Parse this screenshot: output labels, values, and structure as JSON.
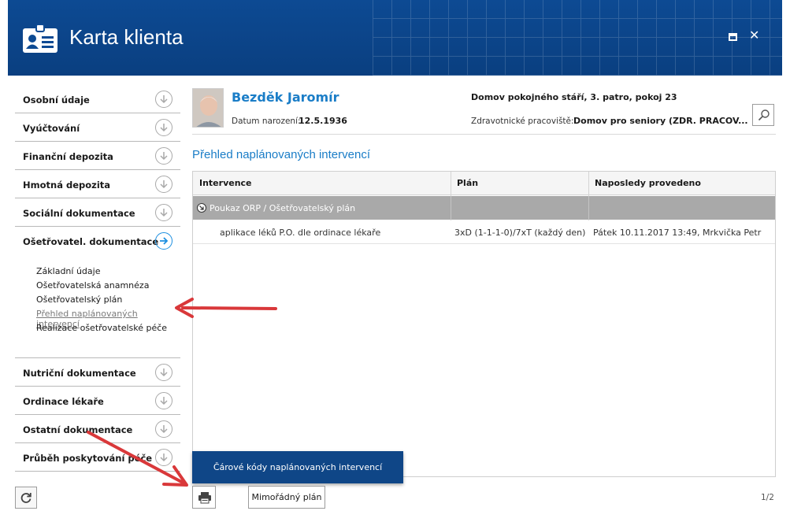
{
  "window": {
    "title": "Karta klienta",
    "maximize_icon": "maximize-icon",
    "close_icon": "close-icon"
  },
  "sidebar": {
    "sections_top": [
      {
        "label": "Osobní údaje",
        "icon": "chevron-down-circle-icon"
      },
      {
        "label": "Vyúčtování",
        "icon": "chevron-down-circle-icon"
      },
      {
        "label": "Finanční depozita",
        "icon": "chevron-down-circle-icon"
      },
      {
        "label": "Hmotná depozita",
        "icon": "chevron-down-circle-icon"
      },
      {
        "label": "Sociální dokumentace",
        "icon": "chevron-down-circle-icon"
      }
    ],
    "active_section": {
      "label": "Ošetřovatel. dokumentace",
      "icon": "arrow-right-circle-icon"
    },
    "subitems": [
      {
        "label": "Základní údaje"
      },
      {
        "label": "Ošetřovatelská anamnéza"
      },
      {
        "label": "Ošetřovatelský plán"
      },
      {
        "label": "Přehled naplánovaných intervencí",
        "current": true
      },
      {
        "label": "Realizace ošetřovatelské péče"
      }
    ],
    "sections_bottom": [
      {
        "label": "Nutriční dokumentace",
        "icon": "chevron-down-circle-icon"
      },
      {
        "label": "Ordinace lékaře",
        "icon": "chevron-down-circle-icon"
      },
      {
        "label": "Ostatní dokumentace",
        "icon": "chevron-down-circle-icon"
      },
      {
        "label": "Průběh poskytování péče",
        "icon": "chevron-down-circle-icon"
      }
    ],
    "refresh_icon": "refresh-icon"
  },
  "client": {
    "name": "Bezděk Jaromír",
    "dob_label": "Datum narození:",
    "dob_value": "12.5.1936",
    "location": "Domov pokojného stáří, 3. patro, pokoj 23",
    "workplace_label": "Zdravotnické pracoviště:",
    "workplace_value": "Domov pro seniory (ZDR. PRACOV..."
  },
  "main": {
    "section_title": "Přehled naplánovaných intervencí",
    "table": {
      "columns": [
        "Intervence",
        "Plán",
        "Naposledy provedeno"
      ],
      "group": "Poukaz ORP / Ošetřovatelský plán",
      "rows": [
        [
          "aplikace léků P.O. dle ordinace lékaře",
          "3xD (1-1-1-0)/7xT (každý den)",
          "Pátek 10.11.2017 13:49, Mrkvička Petr"
        ]
      ]
    },
    "barcode_button": "Čárové kódy naplánovaných intervencí",
    "extra_plan_button": "Mimořádný plán",
    "pager": "1/2",
    "print_icon": "printer-icon",
    "search_icon": "search-icon"
  },
  "colors": {
    "header_blue": "#0d4a93",
    "accent_blue": "#1a7dc7",
    "group_row_gray": "#a9a9a9",
    "annotation_red": "#d9383a"
  }
}
